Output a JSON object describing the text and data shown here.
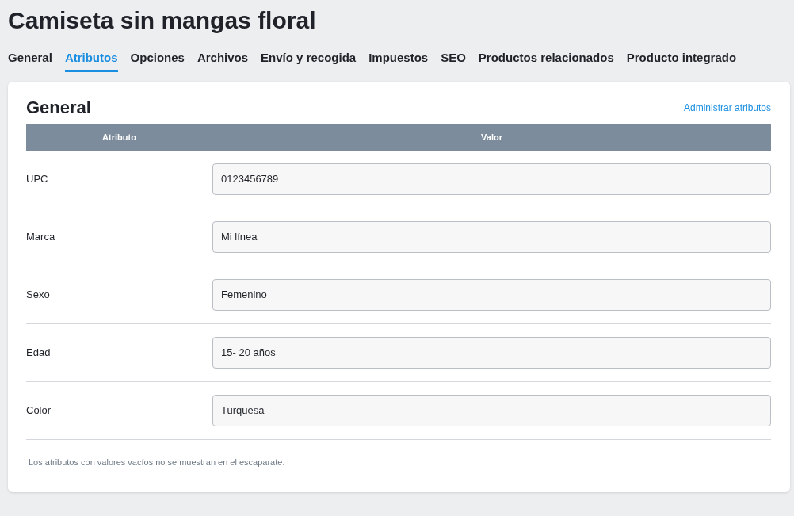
{
  "page_title": "Camiseta sin mangas floral",
  "tabs": [
    {
      "label": "General",
      "selected": false
    },
    {
      "label": "Atributos",
      "selected": true
    },
    {
      "label": "Opciones",
      "selected": false
    },
    {
      "label": "Archivos",
      "selected": false
    },
    {
      "label": "Envío y recogida",
      "selected": false
    },
    {
      "label": "Impuestos",
      "selected": false
    },
    {
      "label": "SEO",
      "selected": false
    },
    {
      "label": "Productos relacionados",
      "selected": false
    },
    {
      "label": "Producto integrado",
      "selected": false
    }
  ],
  "section": {
    "title": "General",
    "manage_link": "Administrar atributos"
  },
  "table": {
    "columns": [
      "Atributo",
      "Valor"
    ],
    "rows": [
      {
        "attribute": "UPC",
        "value": "0123456789"
      },
      {
        "attribute": "Marca",
        "value": "Mi línea"
      },
      {
        "attribute": "Sexo",
        "value": "Femenino"
      },
      {
        "attribute": "Edad",
        "value": "15- 20 años"
      },
      {
        "attribute": "Color",
        "value": "Turquesa"
      }
    ]
  },
  "note": "Los atributos con valores vacíos no se muestran en el escaparate."
}
